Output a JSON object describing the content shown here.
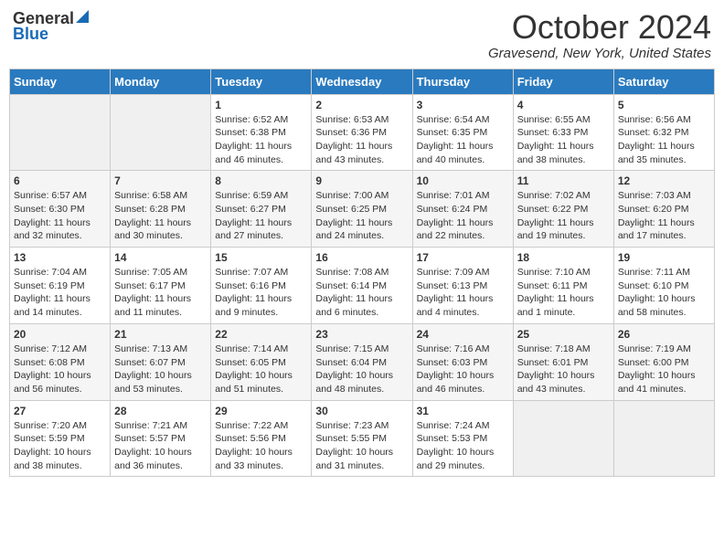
{
  "header": {
    "logo_general": "General",
    "logo_blue": "Blue",
    "month_title": "October 2024",
    "location": "Gravesend, New York, United States"
  },
  "days_of_week": [
    "Sunday",
    "Monday",
    "Tuesday",
    "Wednesday",
    "Thursday",
    "Friday",
    "Saturday"
  ],
  "weeks": [
    [
      {
        "day": "",
        "sunrise": "",
        "sunset": "",
        "daylight": ""
      },
      {
        "day": "",
        "sunrise": "",
        "sunset": "",
        "daylight": ""
      },
      {
        "day": "1",
        "sunrise": "Sunrise: 6:52 AM",
        "sunset": "Sunset: 6:38 PM",
        "daylight": "Daylight: 11 hours and 46 minutes."
      },
      {
        "day": "2",
        "sunrise": "Sunrise: 6:53 AM",
        "sunset": "Sunset: 6:36 PM",
        "daylight": "Daylight: 11 hours and 43 minutes."
      },
      {
        "day": "3",
        "sunrise": "Sunrise: 6:54 AM",
        "sunset": "Sunset: 6:35 PM",
        "daylight": "Daylight: 11 hours and 40 minutes."
      },
      {
        "day": "4",
        "sunrise": "Sunrise: 6:55 AM",
        "sunset": "Sunset: 6:33 PM",
        "daylight": "Daylight: 11 hours and 38 minutes."
      },
      {
        "day": "5",
        "sunrise": "Sunrise: 6:56 AM",
        "sunset": "Sunset: 6:32 PM",
        "daylight": "Daylight: 11 hours and 35 minutes."
      }
    ],
    [
      {
        "day": "6",
        "sunrise": "Sunrise: 6:57 AM",
        "sunset": "Sunset: 6:30 PM",
        "daylight": "Daylight: 11 hours and 32 minutes."
      },
      {
        "day": "7",
        "sunrise": "Sunrise: 6:58 AM",
        "sunset": "Sunset: 6:28 PM",
        "daylight": "Daylight: 11 hours and 30 minutes."
      },
      {
        "day": "8",
        "sunrise": "Sunrise: 6:59 AM",
        "sunset": "Sunset: 6:27 PM",
        "daylight": "Daylight: 11 hours and 27 minutes."
      },
      {
        "day": "9",
        "sunrise": "Sunrise: 7:00 AM",
        "sunset": "Sunset: 6:25 PM",
        "daylight": "Daylight: 11 hours and 24 minutes."
      },
      {
        "day": "10",
        "sunrise": "Sunrise: 7:01 AM",
        "sunset": "Sunset: 6:24 PM",
        "daylight": "Daylight: 11 hours and 22 minutes."
      },
      {
        "day": "11",
        "sunrise": "Sunrise: 7:02 AM",
        "sunset": "Sunset: 6:22 PM",
        "daylight": "Daylight: 11 hours and 19 minutes."
      },
      {
        "day": "12",
        "sunrise": "Sunrise: 7:03 AM",
        "sunset": "Sunset: 6:20 PM",
        "daylight": "Daylight: 11 hours and 17 minutes."
      }
    ],
    [
      {
        "day": "13",
        "sunrise": "Sunrise: 7:04 AM",
        "sunset": "Sunset: 6:19 PM",
        "daylight": "Daylight: 11 hours and 14 minutes."
      },
      {
        "day": "14",
        "sunrise": "Sunrise: 7:05 AM",
        "sunset": "Sunset: 6:17 PM",
        "daylight": "Daylight: 11 hours and 11 minutes."
      },
      {
        "day": "15",
        "sunrise": "Sunrise: 7:07 AM",
        "sunset": "Sunset: 6:16 PM",
        "daylight": "Daylight: 11 hours and 9 minutes."
      },
      {
        "day": "16",
        "sunrise": "Sunrise: 7:08 AM",
        "sunset": "Sunset: 6:14 PM",
        "daylight": "Daylight: 11 hours and 6 minutes."
      },
      {
        "day": "17",
        "sunrise": "Sunrise: 7:09 AM",
        "sunset": "Sunset: 6:13 PM",
        "daylight": "Daylight: 11 hours and 4 minutes."
      },
      {
        "day": "18",
        "sunrise": "Sunrise: 7:10 AM",
        "sunset": "Sunset: 6:11 PM",
        "daylight": "Daylight: 11 hours and 1 minute."
      },
      {
        "day": "19",
        "sunrise": "Sunrise: 7:11 AM",
        "sunset": "Sunset: 6:10 PM",
        "daylight": "Daylight: 10 hours and 58 minutes."
      }
    ],
    [
      {
        "day": "20",
        "sunrise": "Sunrise: 7:12 AM",
        "sunset": "Sunset: 6:08 PM",
        "daylight": "Daylight: 10 hours and 56 minutes."
      },
      {
        "day": "21",
        "sunrise": "Sunrise: 7:13 AM",
        "sunset": "Sunset: 6:07 PM",
        "daylight": "Daylight: 10 hours and 53 minutes."
      },
      {
        "day": "22",
        "sunrise": "Sunrise: 7:14 AM",
        "sunset": "Sunset: 6:05 PM",
        "daylight": "Daylight: 10 hours and 51 minutes."
      },
      {
        "day": "23",
        "sunrise": "Sunrise: 7:15 AM",
        "sunset": "Sunset: 6:04 PM",
        "daylight": "Daylight: 10 hours and 48 minutes."
      },
      {
        "day": "24",
        "sunrise": "Sunrise: 7:16 AM",
        "sunset": "Sunset: 6:03 PM",
        "daylight": "Daylight: 10 hours and 46 minutes."
      },
      {
        "day": "25",
        "sunrise": "Sunrise: 7:18 AM",
        "sunset": "Sunset: 6:01 PM",
        "daylight": "Daylight: 10 hours and 43 minutes."
      },
      {
        "day": "26",
        "sunrise": "Sunrise: 7:19 AM",
        "sunset": "Sunset: 6:00 PM",
        "daylight": "Daylight: 10 hours and 41 minutes."
      }
    ],
    [
      {
        "day": "27",
        "sunrise": "Sunrise: 7:20 AM",
        "sunset": "Sunset: 5:59 PM",
        "daylight": "Daylight: 10 hours and 38 minutes."
      },
      {
        "day": "28",
        "sunrise": "Sunrise: 7:21 AM",
        "sunset": "Sunset: 5:57 PM",
        "daylight": "Daylight: 10 hours and 36 minutes."
      },
      {
        "day": "29",
        "sunrise": "Sunrise: 7:22 AM",
        "sunset": "Sunset: 5:56 PM",
        "daylight": "Daylight: 10 hours and 33 minutes."
      },
      {
        "day": "30",
        "sunrise": "Sunrise: 7:23 AM",
        "sunset": "Sunset: 5:55 PM",
        "daylight": "Daylight: 10 hours and 31 minutes."
      },
      {
        "day": "31",
        "sunrise": "Sunrise: 7:24 AM",
        "sunset": "Sunset: 5:53 PM",
        "daylight": "Daylight: 10 hours and 29 minutes."
      },
      {
        "day": "",
        "sunrise": "",
        "sunset": "",
        "daylight": ""
      },
      {
        "day": "",
        "sunrise": "",
        "sunset": "",
        "daylight": ""
      }
    ]
  ]
}
